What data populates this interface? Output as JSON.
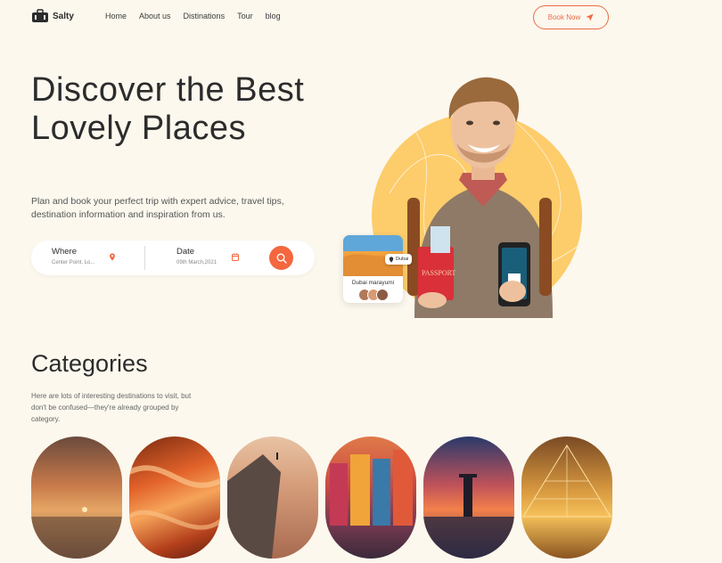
{
  "brand": {
    "name": "Salty",
    "accent": "#f4673f",
    "circle": "#fdcc6b",
    "background": "#fcf8ee"
  },
  "nav": {
    "items": [
      "Home",
      "About us",
      "Distinations",
      "Tour",
      "blog"
    ],
    "book_label": "Book Now"
  },
  "hero": {
    "title": "Discover the Best Lovely Places",
    "subtitle": "Plan and book your perfect trip with expert advice, travel tips, destination information and inspiration from us."
  },
  "search": {
    "where_label": "Where",
    "where_value": "Center Point, Lo...",
    "date_label": "Date",
    "date_value": "09th March,2021"
  },
  "destination_card": {
    "badge": "Dubai",
    "name": "Dubai marayumi"
  },
  "categories": {
    "title": "Categories",
    "subtitle": "Here are lots of interesting destinations to visit, but don't be confused—they're already grouped by category."
  }
}
